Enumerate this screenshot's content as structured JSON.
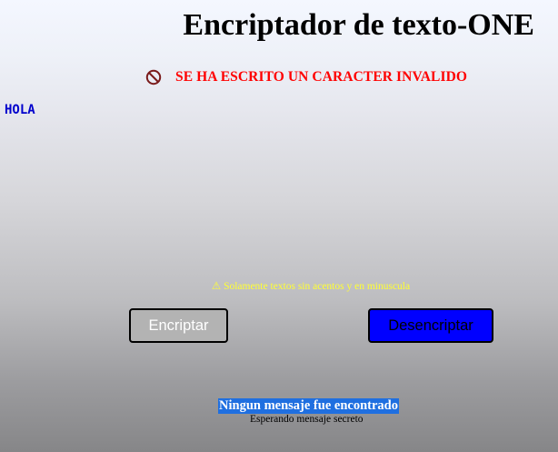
{
  "header": {
    "title": "Encriptador de texto-ONE"
  },
  "error": {
    "icon": "prohibited-icon",
    "message": "SE HA ESCRITO UN CARACTER INVALIDO",
    "color": "#ff0000"
  },
  "input": {
    "value": "HOLA",
    "color": "#0000cc"
  },
  "hint": {
    "icon": "warning-icon",
    "glyph": "⚠",
    "text": "Solamente textos sin acentos y en minuscula",
    "color": "#ffff33"
  },
  "buttons": {
    "encrypt_label": "Encriptar",
    "encrypt_bg": "#b3b3b3",
    "decrypt_label": "Desencriptar",
    "decrypt_bg": "#0000ff"
  },
  "result": {
    "title": "Ningun mensaje fue encontrado",
    "subtitle": "Esperando mensaje secreto",
    "highlight_color": "#1f6fe0"
  }
}
